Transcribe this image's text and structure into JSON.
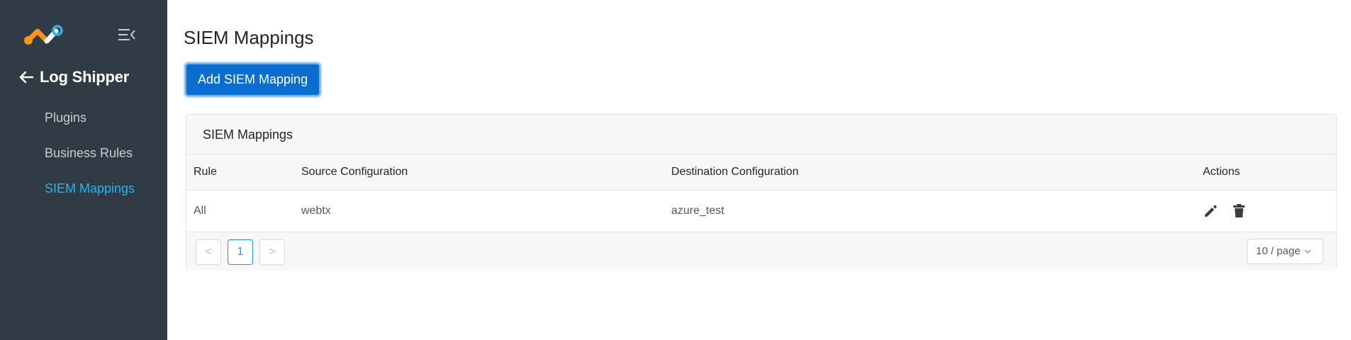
{
  "sidebar": {
    "back_label": "Log Shipper",
    "items": [
      {
        "label": "Plugins"
      },
      {
        "label": "Business Rules"
      },
      {
        "label": "SIEM Mappings"
      }
    ],
    "active_color": "#2ab4e8",
    "background": "#313b45"
  },
  "main": {
    "title": "SIEM Mappings",
    "add_button_label": "Add SIEM Mapping",
    "card_title": "SIEM Mappings",
    "columns": [
      "Rule",
      "Source Configuration",
      "Destination Configuration",
      "Actions"
    ],
    "rows": [
      {
        "rule": "All",
        "source": "webtx",
        "destination": "azure_test",
        "actions": [
          "edit-icon",
          "trash-icon"
        ]
      }
    ],
    "pagination": {
      "prev": "<",
      "current_page": "1",
      "next": ">",
      "page_size": "10 / page"
    }
  }
}
